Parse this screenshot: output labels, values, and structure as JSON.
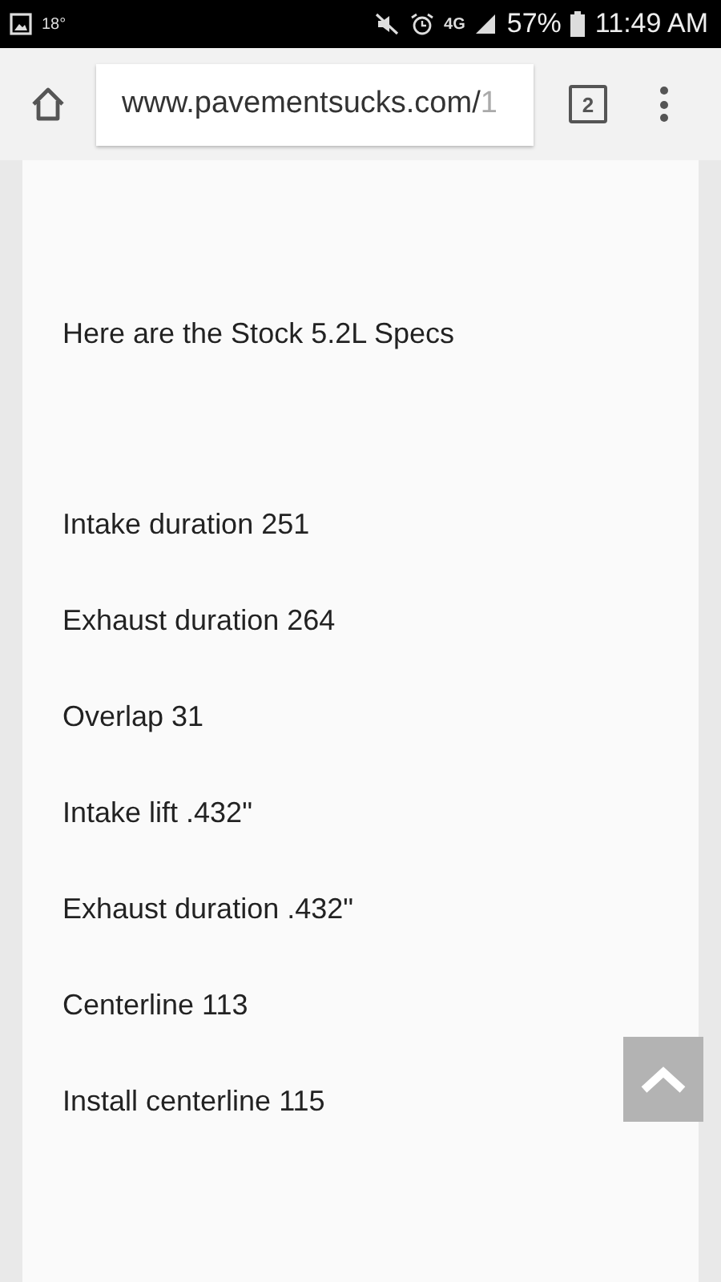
{
  "status_bar": {
    "temperature": "18°",
    "network": "4G",
    "battery": "57%",
    "time": "11:49 AM"
  },
  "toolbar": {
    "url_domain": "www.pavementsucks.com/",
    "url_path": "1",
    "tab_count": "2"
  },
  "article": {
    "heading": "Here are the Stock 5.2L Specs",
    "specs": [
      "Intake duration 251",
      "Exhaust duration 264",
      "Overlap 31",
      "Intake lift .432\"",
      "Exhaust duration .432\"",
      "Centerline 113",
      "Install centerline 115"
    ]
  }
}
